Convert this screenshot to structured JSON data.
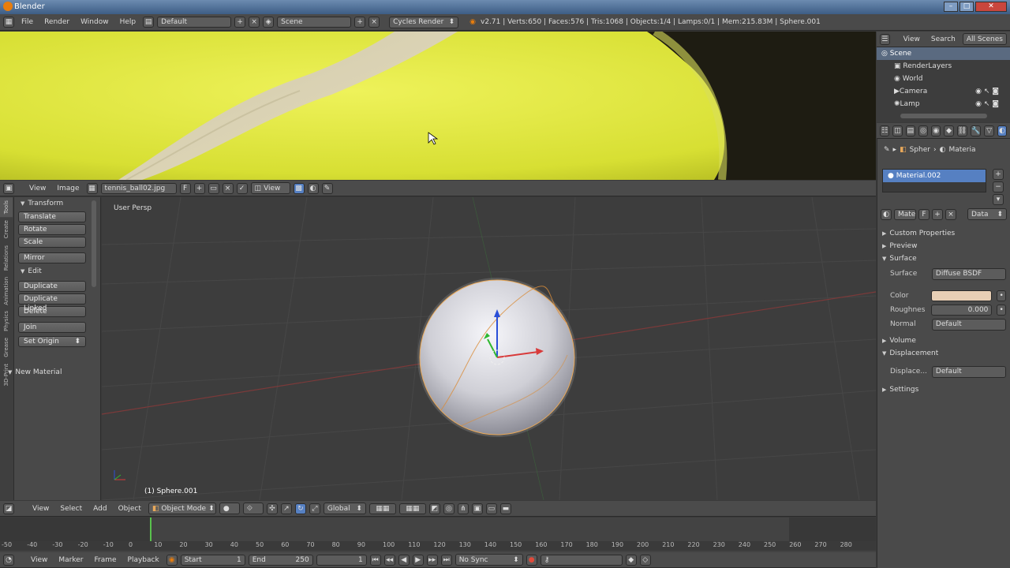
{
  "window": {
    "title": "Blender"
  },
  "info_bar": {
    "menus": [
      "File",
      "Render",
      "Window",
      "Help"
    ],
    "layout": "Default",
    "scene": "Scene",
    "engine": "Cycles Render",
    "stats": "v2.71 | Verts:650 | Faces:576 | Tris:1068 | Objects:1/4 | Lamps:0/1 | Mem:215.83M | Sphere.001"
  },
  "image_editor": {
    "menus": [
      "View",
      "Image"
    ],
    "image_name": "tennis_ball02.jpg",
    "view_label": "View"
  },
  "toolshelf": {
    "tabs": [
      "Tools",
      "Create",
      "Relations",
      "Animation",
      "Physics",
      "Grease",
      "3D-Print"
    ],
    "transform_header": "Transform",
    "transform_buttons": [
      "Translate",
      "Rotate",
      "Scale"
    ],
    "mirror": "Mirror",
    "edit_header": "Edit",
    "edit_buttons": [
      "Duplicate",
      "Duplicate Linked",
      "Delete"
    ],
    "join": "Join",
    "set_origin": "Set Origin",
    "new_material": "New Material"
  },
  "viewport": {
    "view_label": "User Persp",
    "object_label": "(1) Sphere.001",
    "menus": [
      "View",
      "Select",
      "Add",
      "Object"
    ],
    "mode": "Object Mode",
    "orientation": "Global"
  },
  "outliner": {
    "menus": [
      "View",
      "Search",
      "All Scenes"
    ],
    "items": [
      "Scene",
      "RenderLayers",
      "World",
      "Camera",
      "Lamp"
    ]
  },
  "properties": {
    "breadcrumb": [
      "Spher",
      "Materia"
    ],
    "material_slot": "Material.002",
    "material_field": "Mate",
    "data_select": "Data",
    "sections": {
      "custom_props": "Custom Properties",
      "preview": "Preview",
      "surface": "Surface",
      "volume": "Volume",
      "displacement": "Displacement",
      "settings": "Settings"
    },
    "surface_label": "Surface",
    "surface_value": "Diffuse BSDF",
    "color_label": "Color",
    "color_value": "#e8cfb5",
    "roughness_label": "Roughnes",
    "roughness_value": "0.000",
    "normal_label": "Normal",
    "normal_value": "Default",
    "displace_label": "Displace...",
    "displace_value": "Default"
  },
  "timeline": {
    "ticks": [
      "-50",
      "-40",
      "-30",
      "-20",
      "-10",
      "0",
      "10",
      "20",
      "30",
      "40",
      "50",
      "60",
      "70",
      "80",
      "90",
      "100",
      "110",
      "120",
      "130",
      "140",
      "150",
      "160",
      "170",
      "180",
      "190",
      "200",
      "210",
      "220",
      "230",
      "240",
      "250",
      "260",
      "270",
      "280"
    ],
    "menus": [
      "View",
      "Marker",
      "Frame",
      "Playback"
    ],
    "start": "Start",
    "start_value": "1",
    "end": "End",
    "end_value": "250",
    "current_frame": "1",
    "sync": "No Sync"
  },
  "colors": {
    "accent": "#5680c2",
    "ball_yellow": "#d9e13a",
    "grid_bg": "#3d3d3d"
  }
}
